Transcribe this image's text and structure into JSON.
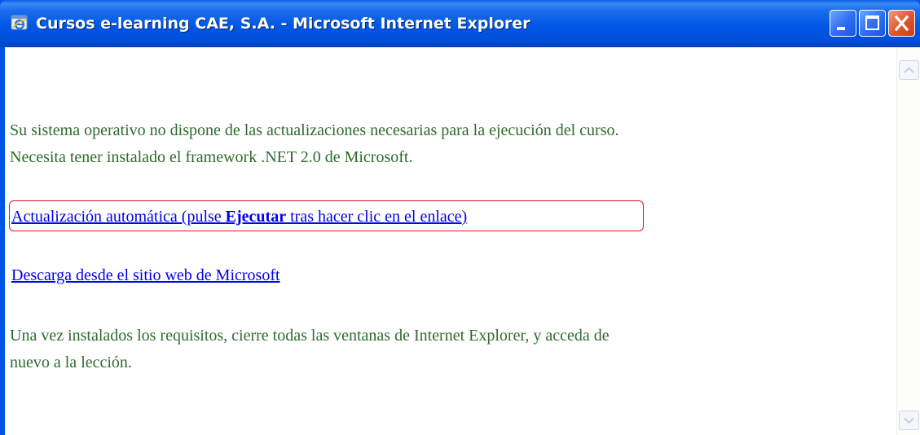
{
  "window": {
    "title": "Cursos e-learning CAE, S.A. - Microsoft Internet Explorer",
    "icon": "internet-explorer-icon"
  },
  "controls": {
    "minimize_icon": "minimize-icon",
    "maximize_icon": "maximize-icon",
    "close_icon": "close-icon"
  },
  "content": {
    "para1_line1": "Su sistema operativo no dispone de las actualizaciones necesarias para la ejecución del curso.",
    "para1_line2": "Necesita tener instalado el framework .NET 2.0 de Microsoft.",
    "link_auto_prefix": "Actualización automática (pulse ",
    "link_auto_bold": "Ejecutar",
    "link_auto_suffix": " tras hacer clic en el enlace)",
    "link_download": "Descarga desde el sitio web de Microsoft",
    "para2_line1": "Una vez instalados los requisitos, cierre todas las ventanas de Internet Explorer, y acceda de",
    "para2_line2": "nuevo a la lección."
  },
  "colors": {
    "title_bar": "#0054e3",
    "text": "#2e6b2e",
    "link": "#0000ee",
    "highlight": "#e8101c",
    "close_button": "#e0562e"
  }
}
